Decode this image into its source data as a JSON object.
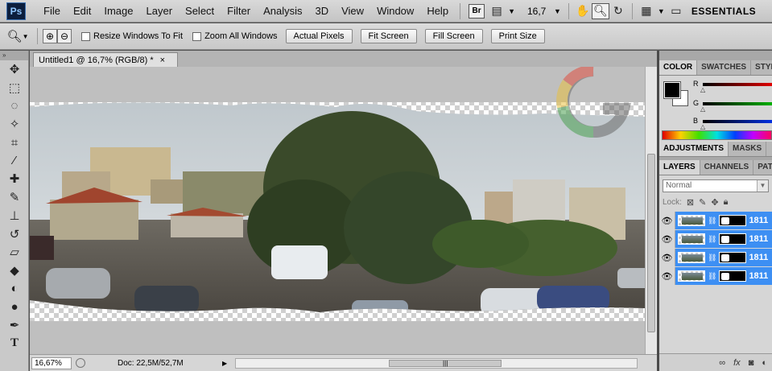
{
  "app": {
    "logo": "Ps"
  },
  "menu": [
    "File",
    "Edit",
    "Image",
    "Layer",
    "Select",
    "Filter",
    "Analysis",
    "3D",
    "View",
    "Window",
    "Help"
  ],
  "appbar": {
    "bridge_label": "Br",
    "zoom_value": "16,7",
    "workspace": "ESSENTIALS",
    "icons": [
      "bridge-icon",
      "screen-mode-icon",
      "hand-icon",
      "zoom-icon",
      "rotate-view-icon",
      "arrange-documents-icon",
      "screen-layout-icon"
    ]
  },
  "options": {
    "resize_windows": "Resize Windows To Fit",
    "zoom_all": "Zoom All Windows",
    "buttons": [
      "Actual Pixels",
      "Fit Screen",
      "Fill Screen",
      "Print Size"
    ]
  },
  "tools": [
    "move-icon",
    "marquee-icon",
    "lasso-icon",
    "magic-wand-icon",
    "crop-icon",
    "eyedropper-icon",
    "spot-healing-icon",
    "brush-icon",
    "clone-stamp-icon",
    "history-brush-icon",
    "eraser-icon",
    "paint-bucket-icon",
    "dodge-icon",
    "burn-icon",
    "pen-icon",
    "type-icon"
  ],
  "document": {
    "tab_title": "Untitled1 @ 16,7% (RGB/8) *",
    "close": "×",
    "status_zoom": "16,67%",
    "status_doc": "Doc: 22,5M/52,7M"
  },
  "color_panel": {
    "tabs": [
      "COLOR",
      "SWATCHES",
      "STYL"
    ],
    "channels": [
      {
        "label": "R",
        "color": "#e00000"
      },
      {
        "label": "G",
        "color": "#00b000"
      },
      {
        "label": "B",
        "color": "#0030e0"
      }
    ]
  },
  "adjust_panel": {
    "tabs": [
      "ADJUSTMENTS",
      "MASKS"
    ]
  },
  "layers_panel": {
    "tabs": [
      "LAYERS",
      "CHANNELS",
      "PAT"
    ],
    "blend_mode": "Normal",
    "lock_label": "Lock:",
    "layers": [
      {
        "name": "1811"
      },
      {
        "name": "1811"
      },
      {
        "name": "1811"
      },
      {
        "name": "1811"
      }
    ]
  }
}
